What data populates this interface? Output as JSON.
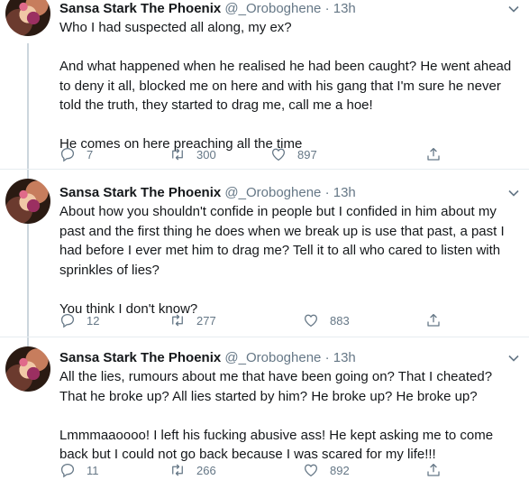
{
  "tweets": [
    {
      "name": "Sansa Stark The Phoenix",
      "handle": "@_Oroboghene",
      "separator": "·",
      "time": "13h",
      "paragraphs": [
        "Who I had suspected all along, my ex?",
        "And what happened when he realised he had been caught? He went ahead to deny it all, blocked me on here and with his gang that I'm sure he never told the truth, they started to drag me, call me a hoe!",
        "He comes on here preaching all the time"
      ],
      "replies": "7",
      "retweets": "300",
      "likes": "897"
    },
    {
      "name": "Sansa Stark The Phoenix",
      "handle": "@_Oroboghene",
      "separator": "·",
      "time": "13h",
      "paragraphs": [
        "About how you shouldn't confide in people but I confided in him about my past and the first thing he does when we break up is use that past, a past I had before I ever met him to drag me? Tell it to all who cared to listen with sprinkles of lies?",
        "You think I don't know?"
      ],
      "replies": "12",
      "retweets": "277",
      "likes": "883"
    },
    {
      "name": "Sansa Stark The Phoenix",
      "handle": "@_Oroboghene",
      "separator": "·",
      "time": "13h",
      "paragraphs": [
        "All the lies, rumours about me that have been going on? That I cheated? That he broke up? All lies started by him? He broke up? He broke up?",
        "Lmmmaaoooo! I left his fucking abusive ass! He kept asking me to come back but I could not go back because I was scared for my life!!!"
      ],
      "replies": "11",
      "retweets": "266",
      "likes": "892"
    }
  ],
  "icons": {
    "reply": "reply-icon",
    "retweet": "retweet-icon",
    "like": "heart-icon",
    "share": "share-icon",
    "more": "chevron-down-icon"
  },
  "colors": {
    "text": "#14171a",
    "secondary": "#657786",
    "divider": "#e6ecf0",
    "thread_line": "#ccd6dd"
  }
}
